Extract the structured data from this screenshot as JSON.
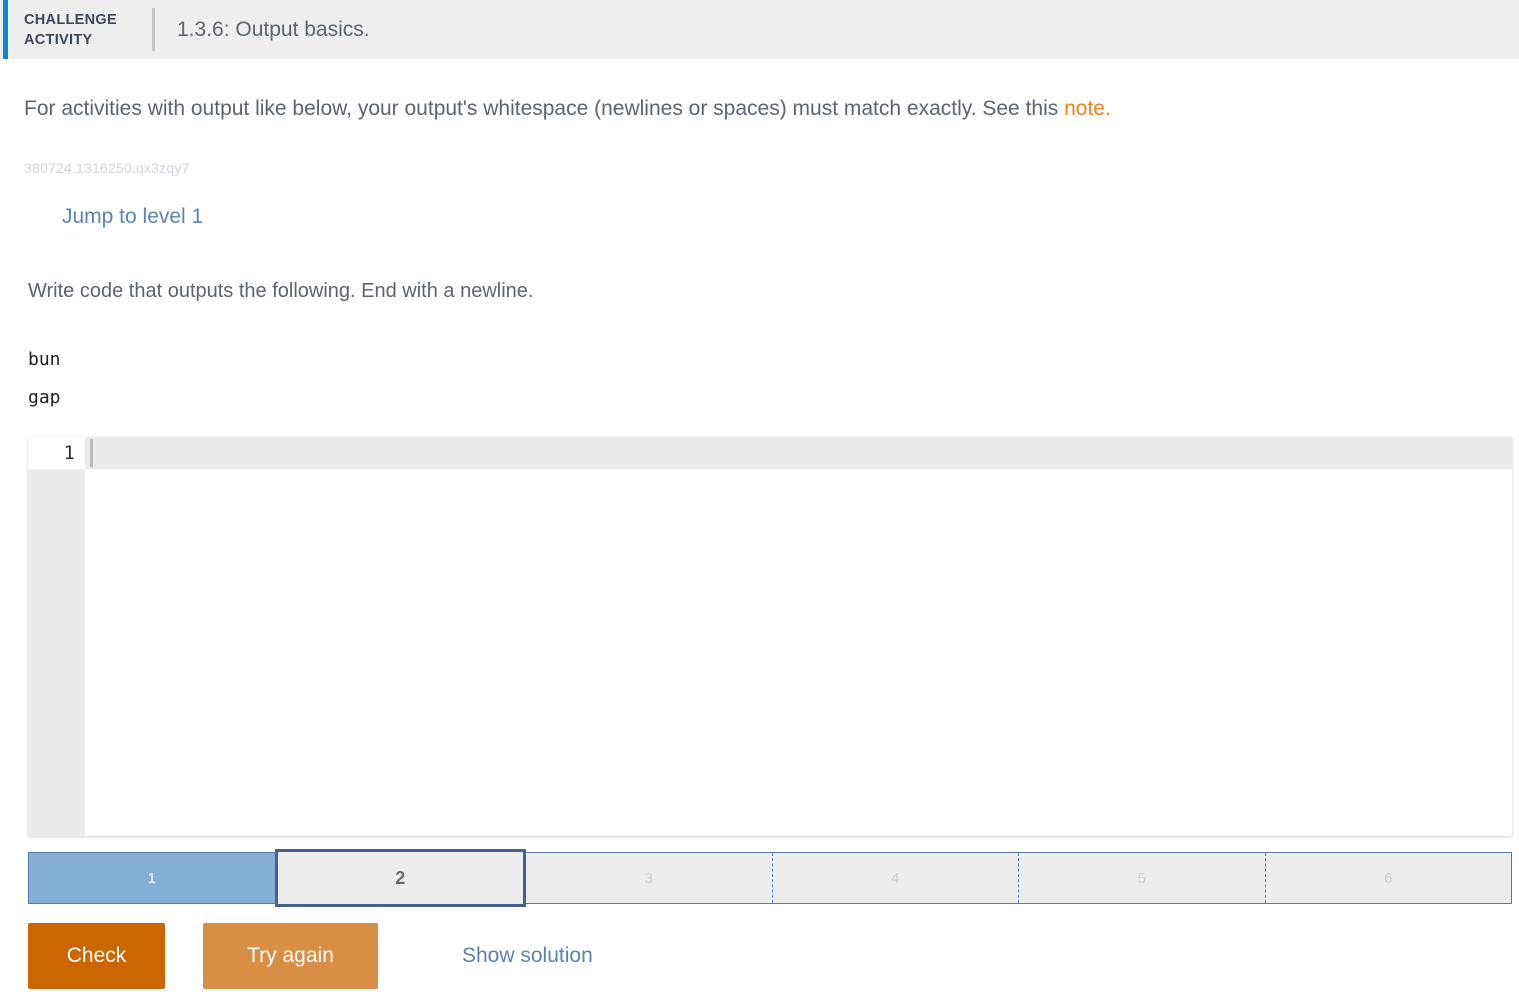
{
  "header": {
    "kicker_line1": "CHALLENGE",
    "kicker_line2": "ACTIVITY",
    "title": "1.3.6: Output basics.",
    "accent_color": "#0d87c9"
  },
  "intro": {
    "text_before": "For activities with output like below, your output's whitespace (newlines or spaces) must match exactly. See this ",
    "note_label": "note.",
    "note_color": "#f4811f"
  },
  "activity_id": "380724.1316250.qx3zqy7",
  "jump_link": {
    "label": "Jump to level 1",
    "color": "#5b84b1"
  },
  "prompt": "Write code that outputs the following. End with a newline.",
  "expected_output": "bun\ngap",
  "editor": {
    "line_number": "1",
    "code_value": "",
    "code_placeholder": ""
  },
  "steps": {
    "items": [
      {
        "label": "1",
        "state": "done"
      },
      {
        "label": "2",
        "state": "current"
      },
      {
        "label": "3",
        "state": "pending"
      },
      {
        "label": "4",
        "state": "pending"
      },
      {
        "label": "5",
        "state": "pending"
      },
      {
        "label": "6",
        "state": "pending"
      }
    ],
    "done_color": "#85aed6",
    "current_border_color": "#44648f",
    "pending_color": "#ededed"
  },
  "footer": {
    "check_label": "Check",
    "check_color": "#cc6600",
    "try_again_label": "Try again",
    "try_again_color": "#d98e45",
    "show_solution_label": "Show solution",
    "show_solution_color": "#5b84b1"
  }
}
